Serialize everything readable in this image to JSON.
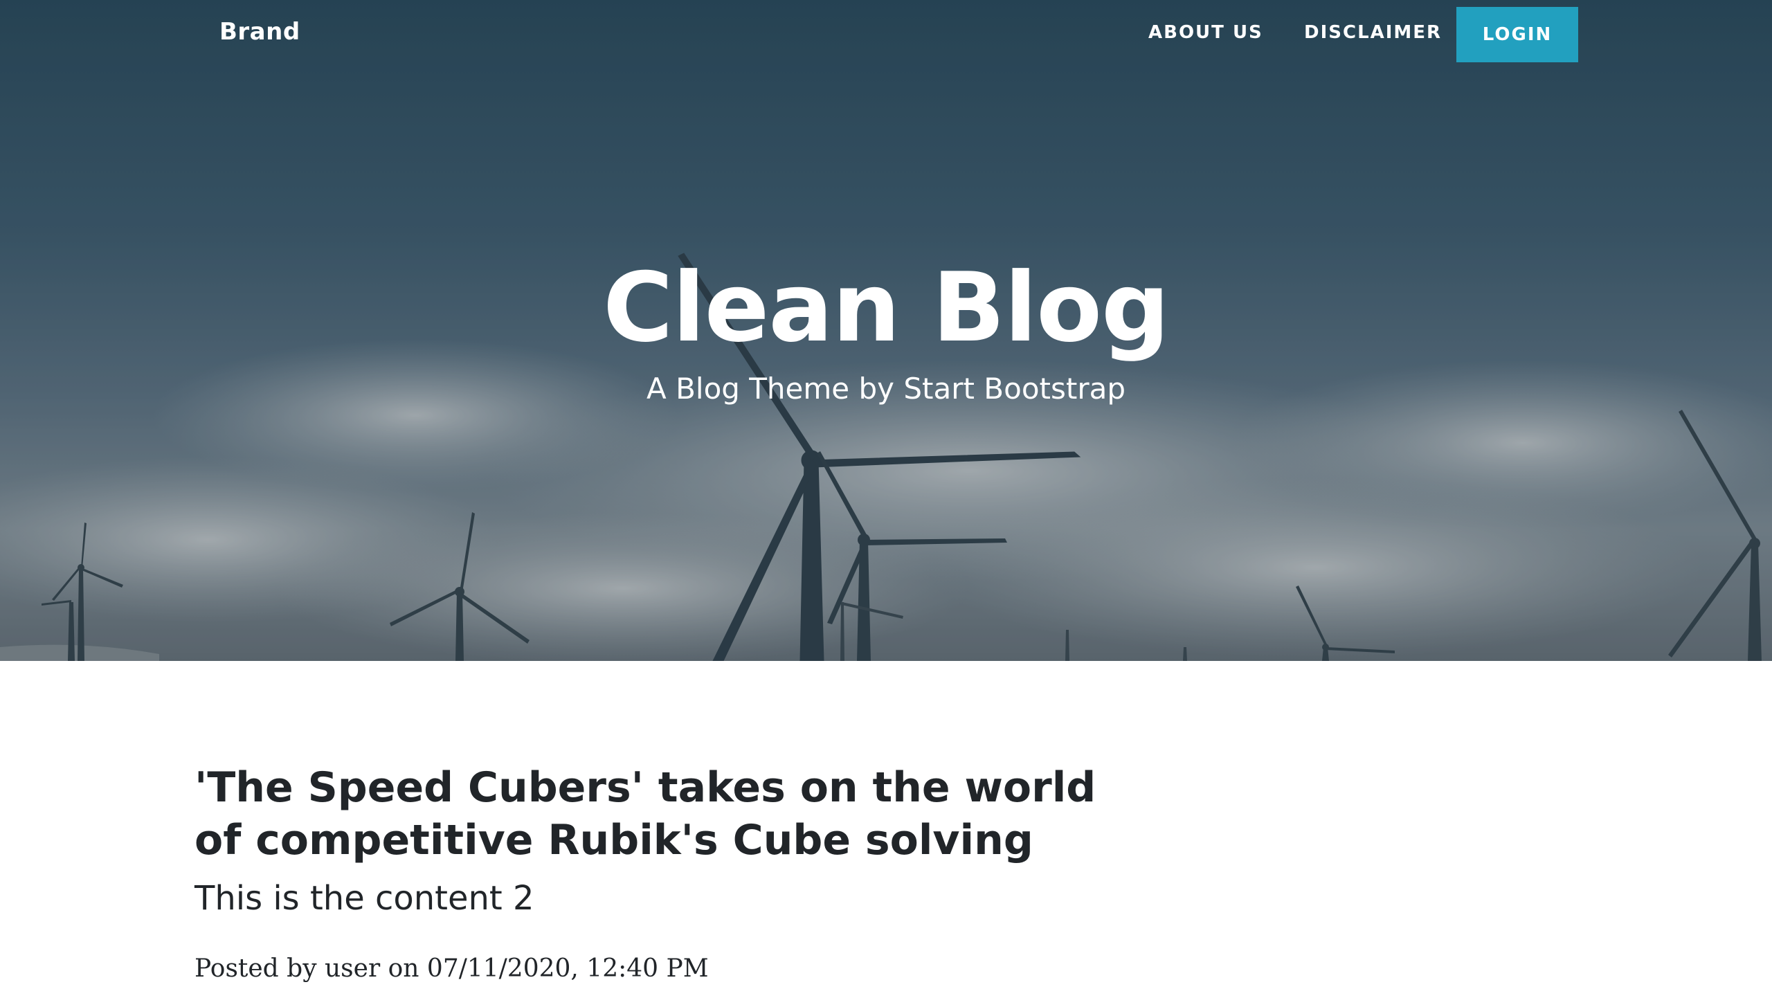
{
  "navbar": {
    "brand": "Brand",
    "links": [
      "ABOUT US",
      "DISCLAIMER"
    ],
    "login_label": "LOGIN",
    "login_color": "#22a0bf"
  },
  "masthead": {
    "title": "Clean Blog",
    "subtitle": "A Blog Theme by Start Bootstrap",
    "background": "wind-turbines-sky"
  },
  "posts": [
    {
      "title": "'The Speed Cubers' takes on the world of competitive Rubik's Cube solving",
      "subtitle": "This is the content 2",
      "meta": "Posted by user on 07/11/2020, 12:40 PM"
    }
  ]
}
